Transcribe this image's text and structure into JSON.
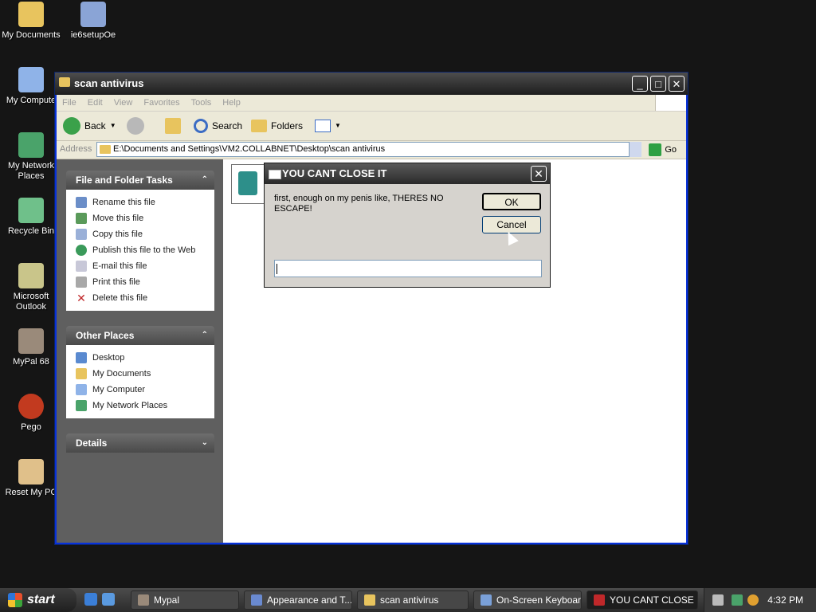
{
  "desktop": {
    "icons": [
      {
        "label": "My Documents"
      },
      {
        "label": "ie6setupOe"
      },
      {
        "label": "My Compute"
      },
      {
        "label": "My Network Places"
      },
      {
        "label": "Recycle Bin"
      },
      {
        "label": "Microsoft Outlook"
      },
      {
        "label": "MyPal 68"
      },
      {
        "label": "Pego"
      },
      {
        "label": "Reset My PC"
      }
    ]
  },
  "explorer": {
    "title": "scan antivirus",
    "menu": [
      "File",
      "Edit",
      "View",
      "Favorites",
      "Tools",
      "Help"
    ],
    "toolbar": {
      "back": "Back",
      "search": "Search",
      "folders": "Folders"
    },
    "address": {
      "label": "Address",
      "value": "E:\\Documents and Settings\\VM2.COLLABNET\\Desktop\\scan antivirus",
      "go": "Go"
    },
    "file_tasks": {
      "title": "File and Folder Tasks",
      "items": [
        "Rename this file",
        "Move this file",
        "Copy this file",
        "Publish this file to the Web",
        "E-mail this file",
        "Print this file",
        "Delete this file"
      ]
    },
    "other_places": {
      "title": "Other Places",
      "items": [
        "Desktop",
        "My Documents",
        "My Computer",
        "My Network Places"
      ]
    },
    "details": {
      "title": "Details"
    }
  },
  "dialog": {
    "title": "YOU CANT CLOSE IT",
    "message": "first, enough on my penis like, THERES NO ESCAPE!",
    "ok": "OK",
    "cancel": "Cancel",
    "input_value": ""
  },
  "taskbar": {
    "start": "start",
    "tasks": [
      "Mypal",
      "Appearance and T...",
      "scan antivirus",
      "On-Screen Keyboard",
      "YOU CANT CLOSE IT"
    ],
    "clock": "4:32 PM"
  },
  "colors": {
    "accent": "#0831d9",
    "dark_theme": "#2b2b2b"
  }
}
